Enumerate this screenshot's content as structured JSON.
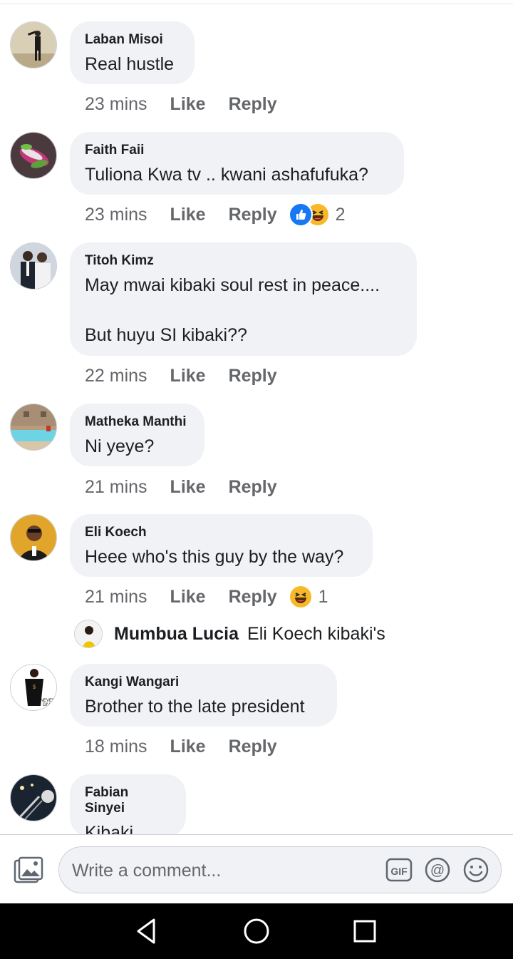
{
  "comments": [
    {
      "author": "Laban Misoi",
      "text": "Real hustle",
      "time": "23 mins",
      "like": "Like",
      "reply": "Reply"
    },
    {
      "author": "Faith Faii",
      "text": "Tuliona Kwa tv .. kwani ashafufuka?",
      "time": "23 mins",
      "like": "Like",
      "reply": "Reply",
      "reactions": [
        "like",
        "haha"
      ],
      "reaction_count": "2"
    },
    {
      "author": "Titoh Kimz",
      "text": "May mwai kibaki soul rest in peace....\n\nBut huyu SI kibaki??",
      "time": "22 mins",
      "like": "Like",
      "reply": "Reply"
    },
    {
      "author": "Matheka Manthi",
      "text": "Ni yeye?",
      "time": "21 mins",
      "like": "Like",
      "reply": "Reply"
    },
    {
      "author": "Eli Koech",
      "text": "Heee who's this guy by the way?",
      "time": "21 mins",
      "like": "Like",
      "reply": "Reply",
      "reactions": [
        "haha"
      ],
      "reaction_count": "1"
    },
    {
      "author": "Kangi Wangari",
      "text": "Brother to the late president",
      "time": "18 mins",
      "like": "Like",
      "reply": "Reply"
    },
    {
      "author": "Fabian Sinyei",
      "text": "Kibaki"
    }
  ],
  "reply_preview": {
    "author": "Mumbua Lucia",
    "text": "Eli Koech kibaki's"
  },
  "composer": {
    "placeholder": "Write a comment..."
  },
  "icons": {
    "photo": "photo-icon",
    "gif": "gif-icon",
    "mention": "at-icon",
    "emoji": "emoji-icon",
    "back": "back-triangle-icon",
    "home": "home-circle-icon",
    "recents": "recents-square-icon",
    "like_reaction": "thumbs-up-icon",
    "haha_reaction": "laughing-face-icon"
  },
  "colors": {
    "bubble": "#f0f2f5",
    "meta_text": "#65676b",
    "like_blue": "#1877f2",
    "haha_yellow": "#f7b928",
    "nav_bar": "#000000"
  }
}
